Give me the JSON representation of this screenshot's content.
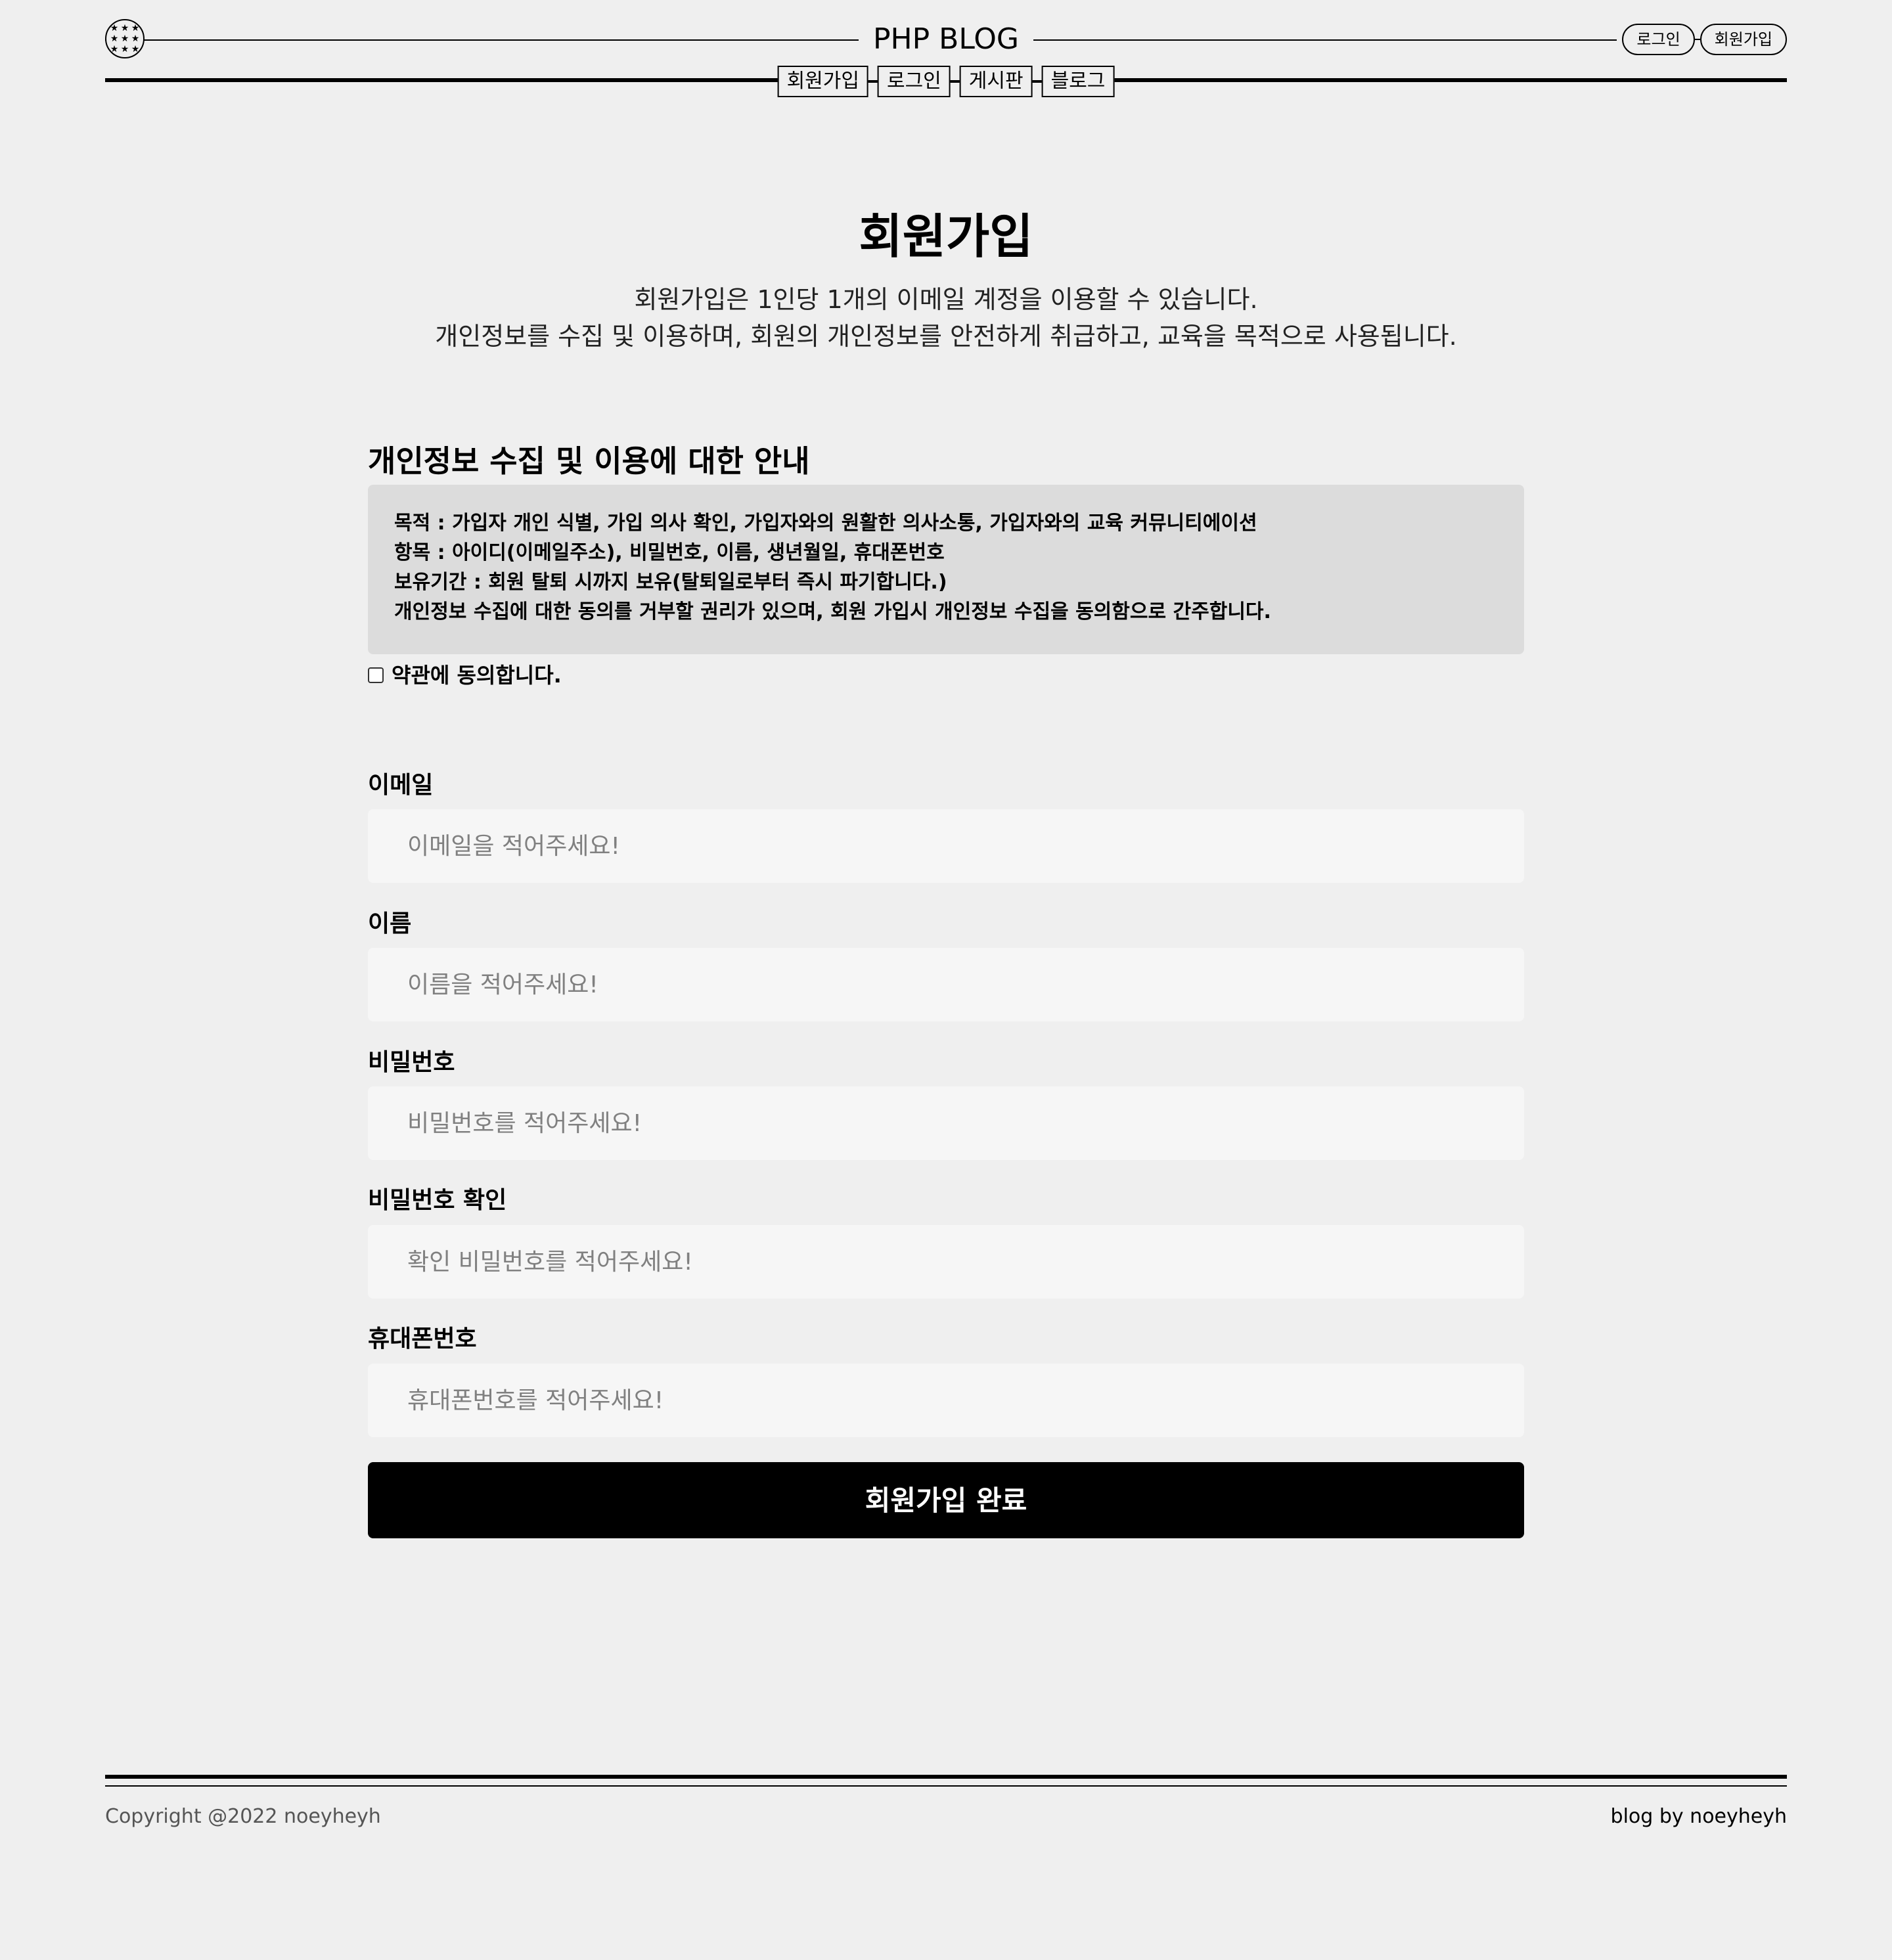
{
  "header": {
    "logo_icon": "star-circle-logo",
    "title": "PHP BLOG",
    "auth": {
      "login_label": "로그인",
      "signup_label": "회원가입"
    },
    "nav": [
      {
        "label": "회원가입"
      },
      {
        "label": "로그인"
      },
      {
        "label": "게시판"
      },
      {
        "label": "블로그"
      }
    ]
  },
  "main": {
    "title": "회원가입",
    "intro": [
      "회원가입은 1인당 1개의 이메일 계정을 이용할 수 있습니다.",
      "개인정보를 수집 및 이용하며, 회원의 개인정보를 안전하게 취급하고, 교육을 목적으로 사용됩니다."
    ],
    "terms": {
      "heading": "개인정보 수집 및 이용에 대한 안내",
      "lines": [
        "목적 : 가입자 개인 식별, 가입 의사 확인, 가입자와의 원활한 의사소통, 가입자와의 교육 커뮤니티에이션",
        "항목 : 아이디(이메일주소), 비밀번호, 이름, 생년월일, 휴대폰번호",
        "보유기간 : 회원 탈퇴 시까지 보유(탈퇴일로부터 즉시 파기합니다.)",
        "개인정보 수집에 대한 동의를 거부할 권리가 있으며, 회원 가입시 개인정보 수집을 동의함으로 간주합니다."
      ],
      "agree_label": "약관에 동의합니다.",
      "agree_checked": false
    },
    "fields": [
      {
        "label": "이메일",
        "placeholder": "이메일을 적어주세요!",
        "value": ""
      },
      {
        "label": "이름",
        "placeholder": "이름을 적어주세요!",
        "value": ""
      },
      {
        "label": "비밀번호",
        "placeholder": "비밀번호를 적어주세요!",
        "value": ""
      },
      {
        "label": "비밀번호 확인",
        "placeholder": "확인 비밀번호를 적어주세요!",
        "value": ""
      },
      {
        "label": "휴대폰번호",
        "placeholder": "휴대폰번호를 적어주세요!",
        "value": ""
      }
    ],
    "submit_label": "회원가입 완료"
  },
  "footer": {
    "copyright": "Copyright @2022 noeyheyh",
    "credit": "blog by noeyheyh"
  },
  "colors": {
    "background": "#efefef",
    "terms_box": "#dcdcdc",
    "input_bg": "#f6f6f6",
    "button_bg": "#000000",
    "button_text": "#ffffff"
  }
}
